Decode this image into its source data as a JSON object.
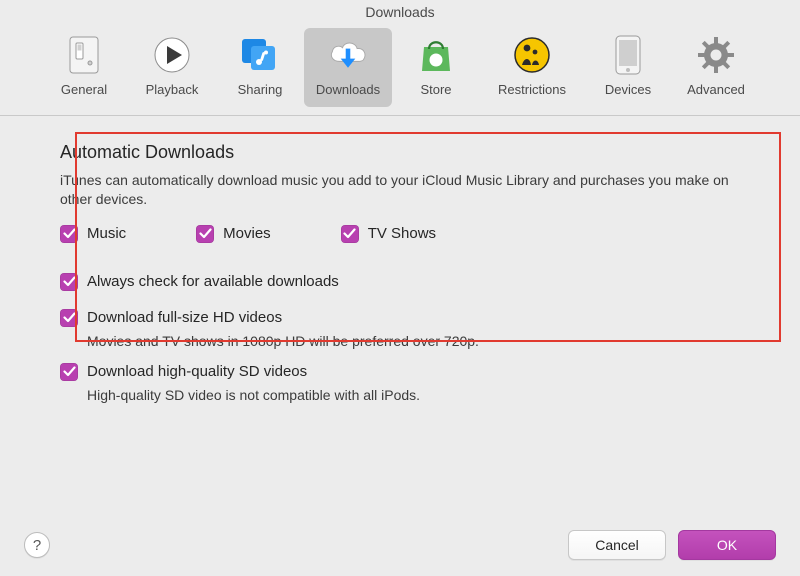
{
  "window": {
    "title": "Downloads"
  },
  "toolbar": {
    "items": [
      {
        "label": "General"
      },
      {
        "label": "Playback"
      },
      {
        "label": "Sharing"
      },
      {
        "label": "Downloads"
      },
      {
        "label": "Store"
      },
      {
        "label": "Restrictions"
      },
      {
        "label": "Devices"
      },
      {
        "label": "Advanced"
      }
    ],
    "selected_index": 3
  },
  "content": {
    "auto_downloads": {
      "title": "Automatic Downloads",
      "desc": "iTunes can automatically download music you add to your iCloud Music Library and purchases you make on other devices.",
      "options": {
        "music": {
          "label": "Music",
          "checked": true
        },
        "movies": {
          "label": "Movies",
          "checked": true
        },
        "tv_shows": {
          "label": "TV Shows",
          "checked": true
        }
      }
    },
    "always_check": {
      "label": "Always check for available downloads",
      "checked": true
    },
    "hd_videos": {
      "label": "Download full-size HD videos",
      "checked": true,
      "desc": "Movies and TV shows in 1080p HD will be preferred over 720p."
    },
    "sd_videos": {
      "label": "Download high-quality SD videos",
      "checked": true,
      "desc": "High-quality SD video is not compatible with all iPods."
    }
  },
  "footer": {
    "help": "?",
    "cancel": "Cancel",
    "ok": "OK"
  },
  "colors": {
    "accent": "#b840b0",
    "highlight_border": "#e13a2f"
  }
}
